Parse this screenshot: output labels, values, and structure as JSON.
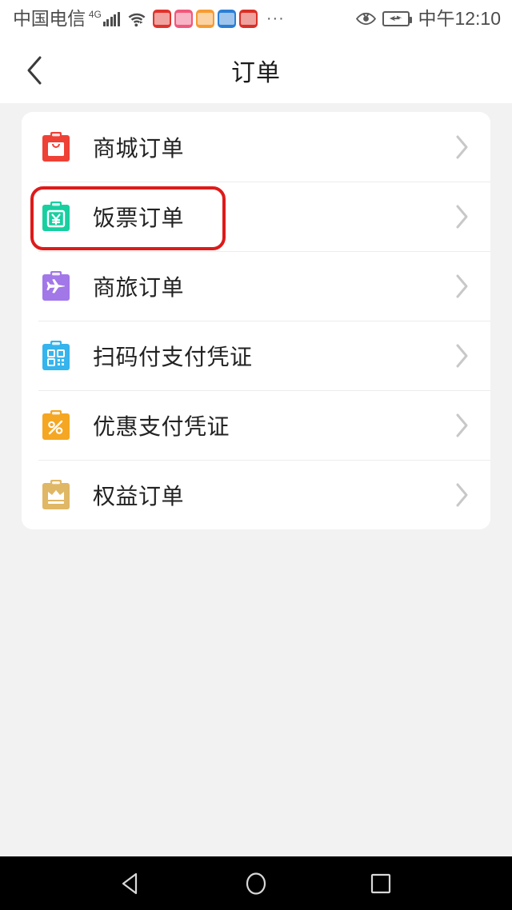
{
  "statusbar": {
    "carrier": "中国电信",
    "network_type": "4G",
    "signal_bars": 5,
    "wifi_icon": "wifi-icon",
    "eye_icon": "eye-icon",
    "battery_icon": "battery-charging-icon",
    "overflow_dots": "···",
    "time": "中午12:10",
    "app_icons": [
      {
        "name": "app-notification-1",
        "color": "#e0342c"
      },
      {
        "name": "app-notification-2",
        "color": "#f0587d"
      },
      {
        "name": "app-notification-3",
        "color": "#f59c32"
      },
      {
        "name": "app-notification-4",
        "color": "#2a7fd4"
      },
      {
        "name": "app-notification-5",
        "color": "#d93027"
      }
    ]
  },
  "header": {
    "back_icon": "chevron-left-icon",
    "title": "订单"
  },
  "list": {
    "items": [
      {
        "label": "商城订单",
        "icon_name": "clipboard-shop-icon",
        "icon_color": "#ef4136",
        "chevron": "chevron-right-icon",
        "highlighted": false
      },
      {
        "label": "饭票订单",
        "icon_name": "clipboard-meal-voucher-icon",
        "icon_color": "#18cfa0",
        "chevron": "chevron-right-icon",
        "highlighted": true
      },
      {
        "label": "商旅订单",
        "icon_name": "clipboard-travel-icon",
        "icon_color": "#a277e8",
        "chevron": "chevron-right-icon",
        "highlighted": false
      },
      {
        "label": "扫码付支付凭证",
        "icon_name": "clipboard-qrcode-icon",
        "icon_color": "#35b4ed",
        "chevron": "chevron-right-icon",
        "highlighted": false
      },
      {
        "label": "优惠支付凭证",
        "icon_name": "clipboard-discount-icon",
        "icon_color": "#f5a623",
        "chevron": "chevron-right-icon",
        "highlighted": false
      },
      {
        "label": "权益订单",
        "icon_name": "clipboard-crown-icon",
        "icon_color": "#e0b765",
        "chevron": "chevron-right-icon",
        "highlighted": false
      }
    ]
  },
  "annotation": {
    "color": "#de1a1a",
    "target_label": "饭票订单"
  },
  "android_nav": {
    "back_label": "back-triangle",
    "home_label": "home-circle",
    "recents_label": "recents-square"
  },
  "colors": {
    "page_background": "#f2f2f2",
    "card_background": "#ffffff",
    "divider": "#ececec",
    "text_primary": "#222222",
    "chevron": "#c8c8c8"
  }
}
